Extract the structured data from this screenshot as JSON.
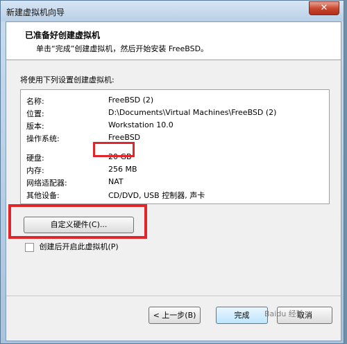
{
  "window": {
    "title": "新建虚拟机向导",
    "close_symbol": "✕"
  },
  "header": {
    "title": "已准备好创建虚拟机",
    "subtitle": "单击“完成”创建虚拟机，然后开始安装 FreeBSD。"
  },
  "intro": "将使用下列设置创建虚拟机:",
  "settings": [
    {
      "key": "名称:",
      "value": "FreeBSD (2)"
    },
    {
      "key": "位置:",
      "value": "D:\\Documents\\Virtual Machines\\FreeBSD (2)"
    },
    {
      "key": "版本:",
      "value": "Workstation 10.0"
    },
    {
      "key": "操作系统:",
      "value": "FreeBSD"
    },
    {
      "key": "硬盘:",
      "value": "20 GB"
    },
    {
      "key": "内存:",
      "value": "256 MB"
    },
    {
      "key": "网络适配器:",
      "value": "NAT"
    },
    {
      "key": "其他设备:",
      "value": "CD/DVD, USB 控制器, 声卡"
    }
  ],
  "custom_hardware_button": "自定义硬件(C)...",
  "power_on_checkbox": {
    "label": "创建后开启此虚拟机(P)",
    "checked": false
  },
  "buttons": {
    "back": "< 上一步(B)",
    "finish": "完成",
    "cancel": "取消"
  },
  "watermark": "Baidu 经验",
  "colors": {
    "highlight": "#e0262b"
  }
}
